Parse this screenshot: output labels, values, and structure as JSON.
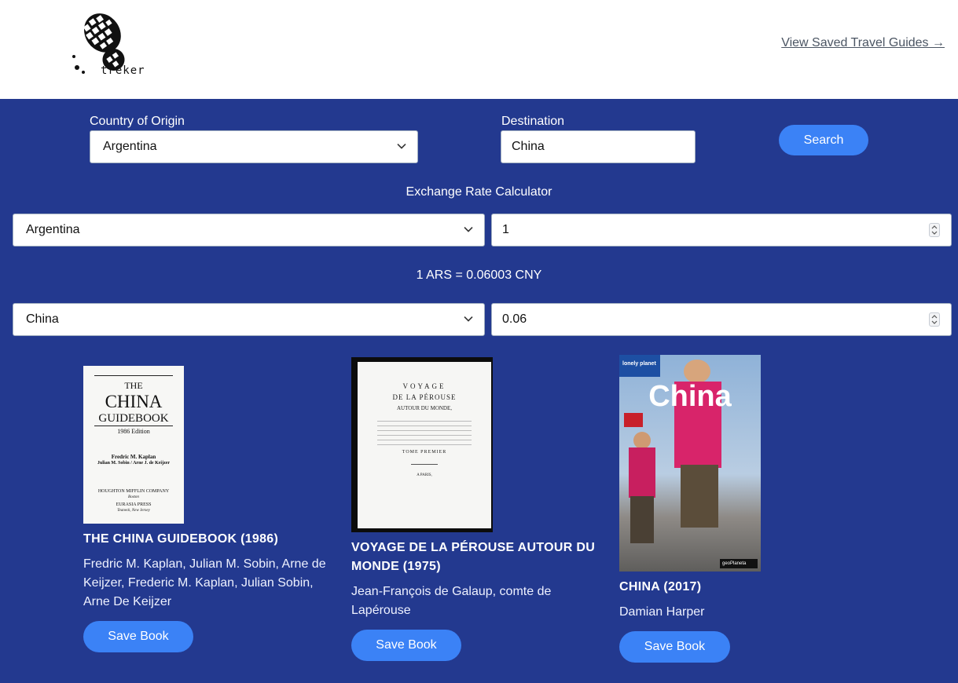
{
  "header": {
    "logo_text": "treker",
    "saved_link": "View Saved Travel Guides →"
  },
  "search": {
    "origin_label": "Country of Origin",
    "origin_value": "Argentina",
    "destination_label": "Destination",
    "destination_value": "China",
    "search_button": "Search"
  },
  "exchange": {
    "title": "Exchange Rate Calculator",
    "from_country": "Argentina",
    "from_amount": "1",
    "rate_text": "1 ARS = 0.06003 CNY",
    "to_country": "China",
    "to_amount": "0.06"
  },
  "books": [
    {
      "title": "THE CHINA GUIDEBOOK (1986)",
      "author_lines": [
        "Fredric M. Kaplan, Julian M. Sobin, Arne de",
        "Keijzer, Frederic M. Kaplan, Julian Sobin,",
        "Arne De Keijzer"
      ],
      "save_label": "Save Book",
      "cover": {
        "line1": "THE",
        "line2": "CHINA",
        "line3": "GUIDEBOOK",
        "edition": "1986 Edition",
        "authors1": "Fredric M. Kaplan",
        "authors2": "Julian M. Sobin / Arne J. de Keijzer",
        "publisher": "HOUGHTON MIFFLIN COMPANY",
        "pub_city": "Boston",
        "press": "EURASIA PRESS",
        "press_city": "Teaneck, New Jersey"
      }
    },
    {
      "title_lines": [
        "VOYAGE DE LA PÉROUSE AUTOUR DU",
        "MONDE (1975)"
      ],
      "author_lines": [
        "Jean-François de Galaup, comte de",
        "Lapérouse"
      ],
      "save_label": "Save Book",
      "cover": {
        "line1": "VOYAGE",
        "line2": "DE LA PÉROUSE",
        "line3": "AUTOUR DU MONDE,",
        "line4": "TOME PREMIER",
        "city": "A PARIS,"
      }
    },
    {
      "title": "CHINA (2017)",
      "author_lines": [
        "Damian Harper"
      ],
      "save_label": "Save Book",
      "cover": {
        "brand": "lonely planet",
        "big": "China",
        "publisher": "geoPlaneta"
      }
    }
  ],
  "colors": {
    "band": "#23398f",
    "button": "#3b82f6",
    "link": "#4b5563"
  }
}
